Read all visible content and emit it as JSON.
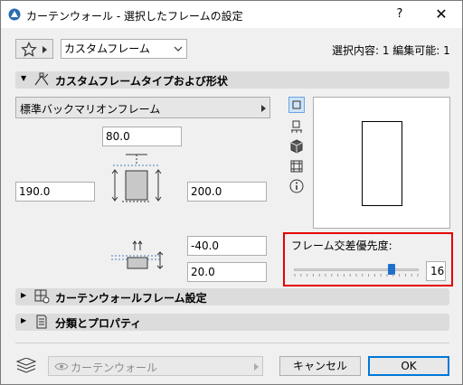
{
  "window": {
    "title": "カーテンウォール - 選択したフレームの設定",
    "help_label": "?",
    "close_label": "✕"
  },
  "toolbar": {
    "favorites_icon": "star-icon",
    "frame_select_value": "カスタムフレーム",
    "selection_info": "選択内容: 1 編集可能: 1"
  },
  "sections": {
    "custom_frame": "カスタムフレームタイプおよび形状",
    "curtain_wall_frame": "カーテンウォールフレーム設定",
    "classification": "分類とプロパティ"
  },
  "frame_type": {
    "label": "標準バックマリオンフレーム"
  },
  "dimensions": {
    "width": "80.0",
    "left": "190.0",
    "right": "200.0",
    "offset": "-40.0",
    "depth": "20.0"
  },
  "priority": {
    "label": "フレーム交差優先度:",
    "value": "16",
    "slider_fraction": 0.8
  },
  "footer": {
    "layer_value": "カーテンウォール",
    "cancel_label": "キャンセル",
    "ok_label": "OK"
  }
}
